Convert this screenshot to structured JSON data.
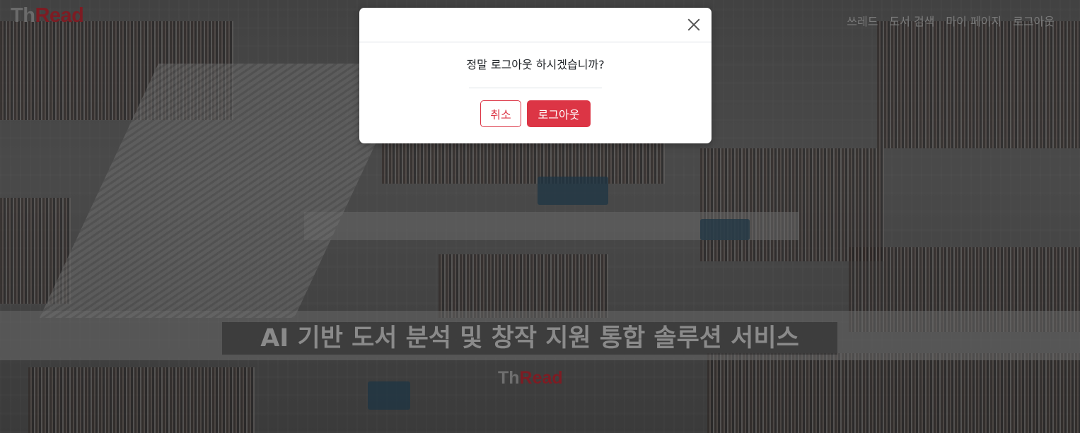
{
  "header": {
    "logo_th": "Th",
    "logo_read": "Read",
    "nav": [
      {
        "label": "쓰레드"
      },
      {
        "label": "도서 검색"
      },
      {
        "label": "마이 페이지"
      },
      {
        "label": "로그아웃"
      }
    ]
  },
  "hero": {
    "headline": "AI 기반 도서 분석 및 창작 지원 통합 솔루션 서비스",
    "logo_th": "Th",
    "logo_read": "Read"
  },
  "modal": {
    "message": "정말 로그아웃 하시겠습니까?",
    "cancel_label": "취소",
    "confirm_label": "로그아웃"
  },
  "colors": {
    "accent": "#dc3545",
    "logo_red": "#7d1c23"
  }
}
